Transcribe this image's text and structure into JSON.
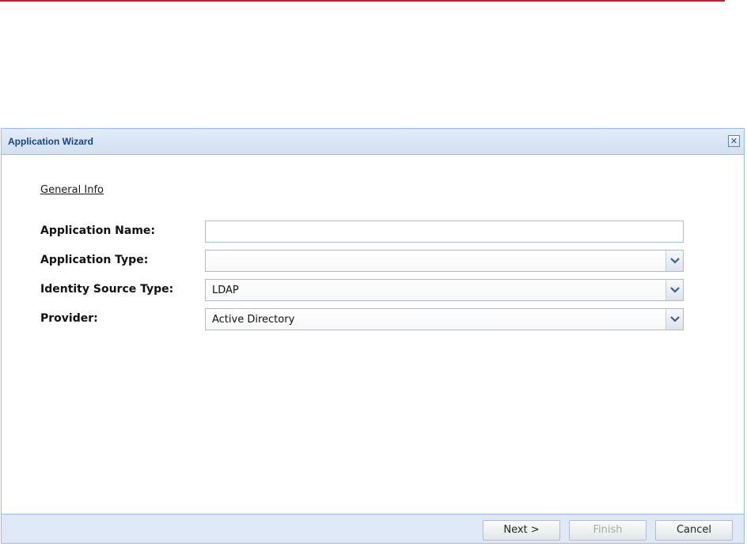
{
  "dialog": {
    "title": "Application Wizard",
    "close_icon": "close-icon"
  },
  "section": {
    "label": "General Info"
  },
  "form": {
    "application_name": {
      "label": "Application Name:",
      "value": ""
    },
    "application_type": {
      "label": "Application Type:",
      "value": ""
    },
    "identity_source_type": {
      "label": "Identity Source Type:",
      "value": "LDAP"
    },
    "provider": {
      "label": "Provider:",
      "value": "Active Directory"
    }
  },
  "footer": {
    "next_label": "Next >",
    "finish_label": "Finish",
    "cancel_label": "Cancel"
  },
  "colors": {
    "accent_rule": "#c0202a",
    "title_text": "#15428b",
    "border": "#99bbe8",
    "footer_bg": "#dfe8f6"
  }
}
